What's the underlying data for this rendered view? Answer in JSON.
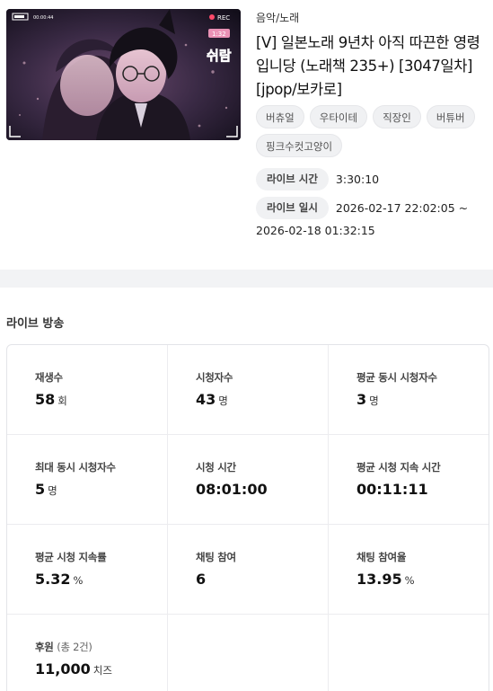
{
  "video": {
    "category": "음악/노래",
    "title": "[V] 일본노래 9년차 아직 따끈한 영령입니당 (노래책 235+) [3047일차] [jpop/보카로]",
    "thumbnail": {
      "hud_time": "00:00:44",
      "rec_label": "REC",
      "counter": "1:32",
      "overlay_text": "쉬람"
    },
    "tags": [
      "버츄얼",
      "우타이테",
      "직장인",
      "버튜버",
      "핑크수컷고양이"
    ],
    "live_time_label": "라이브 시간",
    "live_time_value": "3:30:10",
    "live_date_label": "라이브 일시",
    "live_date_start": "2026-02-17 22:02:05 ~",
    "live_date_end": "2026-02-18 01:32:15"
  },
  "section": {
    "title": "라이브 방송"
  },
  "stats": [
    {
      "label": "재생수",
      "value": "58",
      "unit": "회"
    },
    {
      "label": "시청자수",
      "value": "43",
      "unit": "명"
    },
    {
      "label": "평균 동시 시청자수",
      "value": "3",
      "unit": "명"
    },
    {
      "label": "최대 동시 시청자수",
      "value": "5",
      "unit": "명"
    },
    {
      "label": "시청 시간",
      "value": "08:01:00",
      "unit": ""
    },
    {
      "label": "평균 시청 지속 시간",
      "value": "00:11:11",
      "unit": ""
    },
    {
      "label": "평균 시청 지속률",
      "value": "5.32",
      "unit": "%"
    },
    {
      "label": "채팅 참여",
      "value": "6",
      "unit": ""
    },
    {
      "label": "채팅 참여율",
      "value": "13.95",
      "unit": "%"
    },
    {
      "label": "후원",
      "sub": "(총 2건)",
      "value": "11,000",
      "unit": "치즈"
    }
  ]
}
